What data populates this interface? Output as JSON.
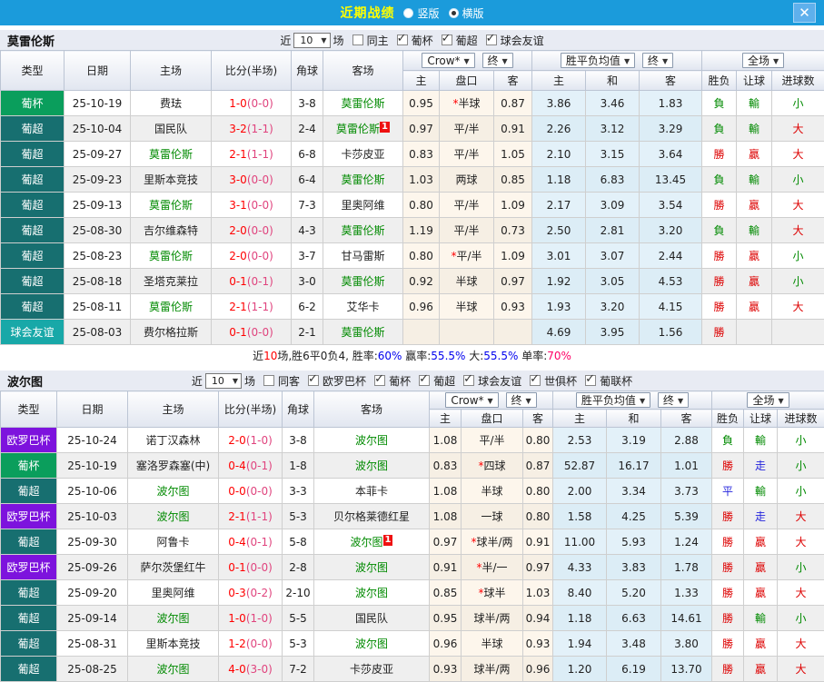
{
  "titlebar": {
    "title": "近期战绩",
    "radios": [
      {
        "label": "竖版",
        "selected": false
      },
      {
        "label": "横版",
        "selected": true
      }
    ],
    "close_label": "✕",
    "bar_color": "#1b9bdb"
  },
  "headers": {
    "left": [
      "类型",
      "日期",
      "主场",
      "比分(半场)",
      "角球",
      "客场"
    ],
    "book": "Crow*",
    "final": "终",
    "avg_label": "胜平负均值",
    "full_label": "全场",
    "sub": [
      "主",
      "盘口",
      "客",
      "主",
      "和",
      "客",
      "胜负",
      "让球",
      "进球数"
    ]
  },
  "league_colors": {
    "葡杯": "#0a9e5c",
    "葡超": "#176f70",
    "球会友谊": "#18a8a8",
    "欧罗巴杯": "#7d13dd"
  },
  "team1": {
    "name": "莫雷伦斯",
    "filter": {
      "near": "近",
      "count": "10",
      "games": "场",
      "same_label": "同主",
      "same_checked": false,
      "leagues": [
        {
          "label": "葡杯",
          "checked": true
        },
        {
          "label": "葡超",
          "checked": true
        },
        {
          "label": "球会友谊",
          "checked": true
        }
      ]
    },
    "rows": [
      {
        "league": "葡杯",
        "date": "25-10-19",
        "home": "费珐",
        "home_active": false,
        "score": "1-0",
        "half": "(0-0)",
        "corner": "3-8",
        "away": "莫雷伦斯",
        "away_active": true,
        "badge": "",
        "badge_side": "",
        "o1": "0.95",
        "handicap": "半球",
        "star": true,
        "o2": "0.87",
        "a1": "3.86",
        "a2": "3.46",
        "a3": "1.83",
        "res": [
          [
            "負",
            "g"
          ],
          [
            "輸",
            "g"
          ],
          [
            "小",
            "g"
          ]
        ]
      },
      {
        "league": "葡超",
        "date": "25-10-04",
        "home": "国民队",
        "home_active": false,
        "score": "3-2",
        "half": "(1-1)",
        "corner": "2-4",
        "away": "莫雷伦斯",
        "away_active": true,
        "badge": "1",
        "badge_side": "away",
        "o1": "0.97",
        "handicap": "平/半",
        "star": false,
        "o2": "0.91",
        "a1": "2.26",
        "a2": "3.12",
        "a3": "3.29",
        "res": [
          [
            "負",
            "g"
          ],
          [
            "輸",
            "g"
          ],
          [
            "大",
            "r"
          ]
        ]
      },
      {
        "league": "葡超",
        "date": "25-09-27",
        "home": "莫雷伦斯",
        "home_active": true,
        "score": "2-1",
        "half": "(1-1)",
        "corner": "6-8",
        "away": "卡莎皮亚",
        "away_active": false,
        "badge": "",
        "badge_side": "",
        "o1": "0.83",
        "handicap": "平/半",
        "star": false,
        "o2": "1.05",
        "a1": "2.10",
        "a2": "3.15",
        "a3": "3.64",
        "res": [
          [
            "勝",
            "r"
          ],
          [
            "贏",
            "r"
          ],
          [
            "大",
            "r"
          ]
        ]
      },
      {
        "league": "葡超",
        "date": "25-09-23",
        "home": "里斯本竞技",
        "home_active": false,
        "score": "3-0",
        "half": "(0-0)",
        "corner": "6-4",
        "away": "莫雷伦斯",
        "away_active": true,
        "badge": "",
        "badge_side": "",
        "o1": "1.03",
        "handicap": "两球",
        "star": false,
        "o2": "0.85",
        "a1": "1.18",
        "a2": "6.83",
        "a3": "13.45",
        "res": [
          [
            "負",
            "g"
          ],
          [
            "輸",
            "g"
          ],
          [
            "小",
            "g"
          ]
        ]
      },
      {
        "league": "葡超",
        "date": "25-09-13",
        "home": "莫雷伦斯",
        "home_active": true,
        "score": "3-1",
        "half": "(0-0)",
        "corner": "7-3",
        "away": "里奥阿维",
        "away_active": false,
        "badge": "",
        "badge_side": "",
        "o1": "0.80",
        "handicap": "平/半",
        "star": false,
        "o2": "1.09",
        "a1": "2.17",
        "a2": "3.09",
        "a3": "3.54",
        "res": [
          [
            "勝",
            "r"
          ],
          [
            "贏",
            "r"
          ],
          [
            "大",
            "r"
          ]
        ]
      },
      {
        "league": "葡超",
        "date": "25-08-30",
        "home": "吉尔维森特",
        "home_active": false,
        "score": "2-0",
        "half": "(0-0)",
        "corner": "4-3",
        "away": "莫雷伦斯",
        "away_active": true,
        "badge": "",
        "badge_side": "",
        "o1": "1.19",
        "handicap": "平/半",
        "star": false,
        "o2": "0.73",
        "a1": "2.50",
        "a2": "2.81",
        "a3": "3.20",
        "res": [
          [
            "負",
            "g"
          ],
          [
            "輸",
            "g"
          ],
          [
            "大",
            "r"
          ]
        ]
      },
      {
        "league": "葡超",
        "date": "25-08-23",
        "home": "莫雷伦斯",
        "home_active": true,
        "score": "2-0",
        "half": "(0-0)",
        "corner": "3-7",
        "away": "甘马雷斯",
        "away_active": false,
        "badge": "",
        "badge_side": "",
        "o1": "0.80",
        "handicap": "平/半",
        "star": true,
        "o2": "1.09",
        "a1": "3.01",
        "a2": "3.07",
        "a3": "2.44",
        "res": [
          [
            "勝",
            "r"
          ],
          [
            "贏",
            "r"
          ],
          [
            "小",
            "g"
          ]
        ]
      },
      {
        "league": "葡超",
        "date": "25-08-18",
        "home": "圣塔克莱拉",
        "home_active": false,
        "score": "0-1",
        "half": "(0-1)",
        "corner": "3-0",
        "away": "莫雷伦斯",
        "away_active": true,
        "badge": "",
        "badge_side": "",
        "o1": "0.92",
        "handicap": "半球",
        "star": false,
        "o2": "0.97",
        "a1": "1.92",
        "a2": "3.05",
        "a3": "4.53",
        "res": [
          [
            "勝",
            "r"
          ],
          [
            "贏",
            "r"
          ],
          [
            "小",
            "g"
          ]
        ]
      },
      {
        "league": "葡超",
        "date": "25-08-11",
        "home": "莫雷伦斯",
        "home_active": true,
        "score": "2-1",
        "half": "(1-1)",
        "corner": "6-2",
        "away": "艾华卡",
        "away_active": false,
        "badge": "",
        "badge_side": "",
        "o1": "0.96",
        "handicap": "半球",
        "star": false,
        "o2": "0.93",
        "a1": "1.93",
        "a2": "3.20",
        "a3": "4.15",
        "res": [
          [
            "勝",
            "r"
          ],
          [
            "贏",
            "r"
          ],
          [
            "大",
            "r"
          ]
        ]
      },
      {
        "league": "球会友谊",
        "date": "25-08-03",
        "home": "费尔格拉斯",
        "home_active": false,
        "score": "0-1",
        "half": "(0-0)",
        "corner": "2-1",
        "away": "莫雷伦斯",
        "away_active": true,
        "badge": "",
        "badge_side": "",
        "o1": "",
        "handicap": "",
        "star": false,
        "o2": "",
        "a1": "4.69",
        "a2": "3.95",
        "a3": "1.56",
        "res": [
          [
            "勝",
            "r"
          ],
          [
            "",
            ""
          ],
          [
            "",
            ""
          ]
        ]
      }
    ],
    "summary": [
      {
        "t": "近",
        "c": "k"
      },
      {
        "t": "10",
        "c": "r"
      },
      {
        "t": "场,胜6平0负4, 胜率:",
        "c": "k"
      },
      {
        "t": "60%",
        "c": "b"
      },
      {
        "t": " 赢率:",
        "c": "k"
      },
      {
        "t": "55.5%",
        "c": "b"
      },
      {
        "t": " 大:",
        "c": "k"
      },
      {
        "t": "55.5%",
        "c": "b"
      },
      {
        "t": " 单率:",
        "c": "k"
      },
      {
        "t": "70%",
        "c": "p"
      }
    ]
  },
  "team2": {
    "name": "波尔图",
    "filter": {
      "near": "近",
      "count": "10",
      "games": "场",
      "same_label": "同客",
      "same_checked": false,
      "leagues": [
        {
          "label": "欧罗巴杯",
          "checked": true
        },
        {
          "label": "葡杯",
          "checked": true
        },
        {
          "label": "葡超",
          "checked": true
        },
        {
          "label": "球会友谊",
          "checked": true
        },
        {
          "label": "世俱杯",
          "checked": true
        },
        {
          "label": "葡联杯",
          "checked": true
        }
      ]
    },
    "rows": [
      {
        "league": "欧罗巴杯",
        "date": "25-10-24",
        "home": "诺丁汉森林",
        "home_active": false,
        "score": "2-0",
        "half": "(1-0)",
        "corner": "3-8",
        "away": "波尔图",
        "away_active": true,
        "badge": "",
        "badge_side": "",
        "o1": "1.08",
        "handicap": "平/半",
        "star": false,
        "o2": "0.80",
        "a1": "2.53",
        "a2": "3.19",
        "a3": "2.88",
        "res": [
          [
            "負",
            "g"
          ],
          [
            "輸",
            "g"
          ],
          [
            "小",
            "g"
          ]
        ]
      },
      {
        "league": "葡杯",
        "date": "25-10-19",
        "home": "塞洛罗森塞(中)",
        "home_active": false,
        "score": "0-4",
        "half": "(0-1)",
        "corner": "1-8",
        "away": "波尔图",
        "away_active": true,
        "badge": "",
        "badge_side": "",
        "o1": "0.83",
        "handicap": "四球",
        "star": true,
        "o2": "0.87",
        "a1": "52.87",
        "a2": "16.17",
        "a3": "1.01",
        "res": [
          [
            "勝",
            "r"
          ],
          [
            "走",
            "b"
          ],
          [
            "小",
            "g"
          ]
        ]
      },
      {
        "league": "葡超",
        "date": "25-10-06",
        "home": "波尔图",
        "home_active": true,
        "score": "0-0",
        "half": "(0-0)",
        "corner": "3-3",
        "away": "本菲卡",
        "away_active": false,
        "badge": "",
        "badge_side": "",
        "o1": "1.08",
        "handicap": "半球",
        "star": false,
        "o2": "0.80",
        "a1": "2.00",
        "a2": "3.34",
        "a3": "3.73",
        "res": [
          [
            "平",
            "b"
          ],
          [
            "輸",
            "g"
          ],
          [
            "小",
            "g"
          ]
        ]
      },
      {
        "league": "欧罗巴杯",
        "date": "25-10-03",
        "home": "波尔图",
        "home_active": true,
        "score": "2-1",
        "half": "(1-1)",
        "corner": "5-3",
        "away": "贝尔格莱德红星",
        "away_active": false,
        "badge": "",
        "badge_side": "",
        "o1": "1.08",
        "handicap": "一球",
        "star": false,
        "o2": "0.80",
        "a1": "1.58",
        "a2": "4.25",
        "a3": "5.39",
        "res": [
          [
            "勝",
            "r"
          ],
          [
            "走",
            "b"
          ],
          [
            "大",
            "r"
          ]
        ]
      },
      {
        "league": "葡超",
        "date": "25-09-30",
        "home": "阿鲁卡",
        "home_active": false,
        "score": "0-4",
        "half": "(0-1)",
        "corner": "5-8",
        "away": "波尔图",
        "away_active": true,
        "badge": "1",
        "badge_side": "away",
        "o1": "0.97",
        "handicap": "球半/两",
        "star": true,
        "o2": "0.91",
        "a1": "11.00",
        "a2": "5.93",
        "a3": "1.24",
        "res": [
          [
            "勝",
            "r"
          ],
          [
            "贏",
            "r"
          ],
          [
            "大",
            "r"
          ]
        ]
      },
      {
        "league": "欧罗巴杯",
        "date": "25-09-26",
        "home": "萨尔茨堡红牛",
        "home_active": false,
        "score": "0-1",
        "half": "(0-0)",
        "corner": "2-8",
        "away": "波尔图",
        "away_active": true,
        "badge": "",
        "badge_side": "",
        "o1": "0.91",
        "handicap": "半/一",
        "star": true,
        "o2": "0.97",
        "a1": "4.33",
        "a2": "3.83",
        "a3": "1.78",
        "res": [
          [
            "勝",
            "r"
          ],
          [
            "贏",
            "r"
          ],
          [
            "小",
            "g"
          ]
        ]
      },
      {
        "league": "葡超",
        "date": "25-09-20",
        "home": "里奥阿维",
        "home_active": false,
        "score": "0-3",
        "half": "(0-2)",
        "corner": "2-10",
        "away": "波尔图",
        "away_active": true,
        "badge": "",
        "badge_side": "",
        "o1": "0.85",
        "handicap": "球半",
        "star": true,
        "o2": "1.03",
        "a1": "8.40",
        "a2": "5.20",
        "a3": "1.33",
        "res": [
          [
            "勝",
            "r"
          ],
          [
            "贏",
            "r"
          ],
          [
            "大",
            "r"
          ]
        ]
      },
      {
        "league": "葡超",
        "date": "25-09-14",
        "home": "波尔图",
        "home_active": true,
        "score": "1-0",
        "half": "(1-0)",
        "corner": "5-5",
        "away": "国民队",
        "away_active": false,
        "badge": "",
        "badge_side": "",
        "o1": "0.95",
        "handicap": "球半/两",
        "star": false,
        "o2": "0.94",
        "a1": "1.18",
        "a2": "6.63",
        "a3": "14.61",
        "res": [
          [
            "勝",
            "r"
          ],
          [
            "輸",
            "g"
          ],
          [
            "小",
            "g"
          ]
        ]
      },
      {
        "league": "葡超",
        "date": "25-08-31",
        "home": "里斯本竞技",
        "home_active": false,
        "score": "1-2",
        "half": "(0-0)",
        "corner": "5-3",
        "away": "波尔图",
        "away_active": true,
        "badge": "",
        "badge_side": "",
        "o1": "0.96",
        "handicap": "半球",
        "star": false,
        "o2": "0.93",
        "a1": "1.94",
        "a2": "3.48",
        "a3": "3.80",
        "res": [
          [
            "勝",
            "r"
          ],
          [
            "贏",
            "r"
          ],
          [
            "大",
            "r"
          ]
        ]
      },
      {
        "league": "葡超",
        "date": "25-08-25",
        "home": "波尔图",
        "home_active": true,
        "score": "4-0",
        "half": "(3-0)",
        "corner": "7-2",
        "away": "卡莎皮亚",
        "away_active": false,
        "badge": "",
        "badge_side": "",
        "o1": "0.93",
        "handicap": "球半/两",
        "star": false,
        "o2": "0.96",
        "a1": "1.20",
        "a2": "6.19",
        "a3": "13.70",
        "res": [
          [
            "勝",
            "r"
          ],
          [
            "贏",
            "r"
          ],
          [
            "大",
            "r"
          ]
        ]
      }
    ]
  }
}
